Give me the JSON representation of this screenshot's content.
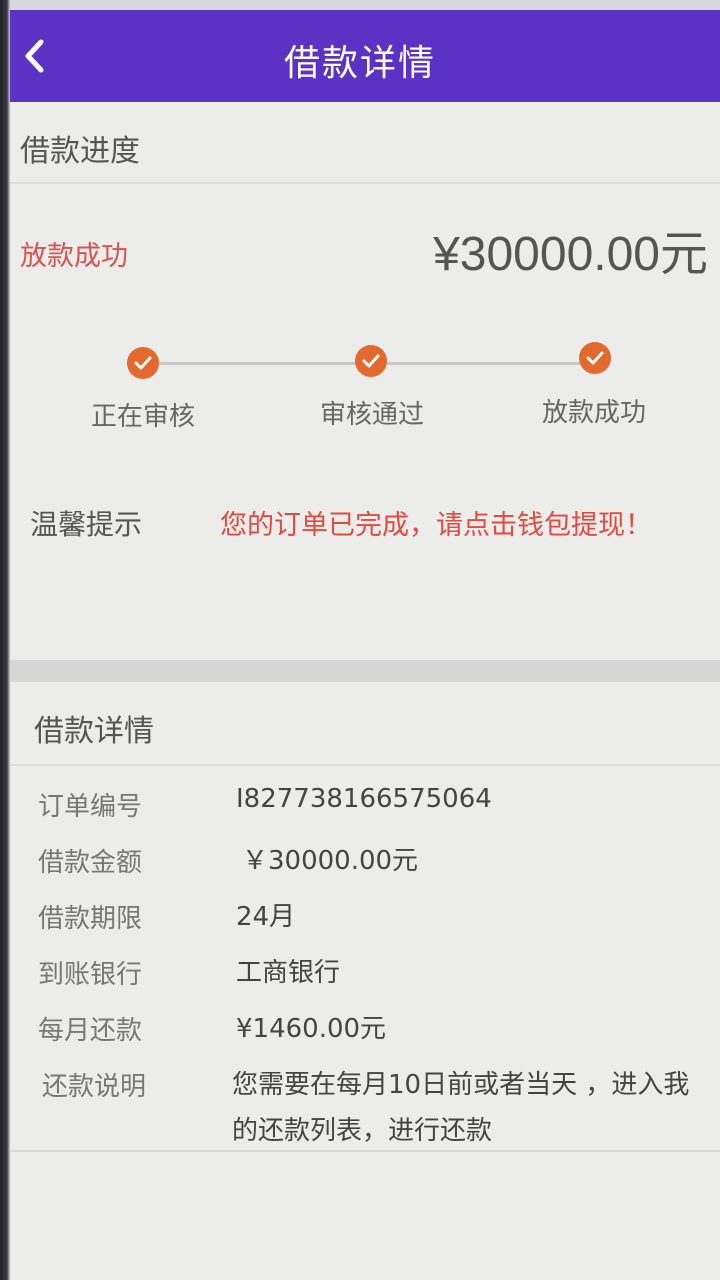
{
  "header": {
    "title": "借款详情"
  },
  "progress_section": {
    "title": "借款进度",
    "status": "放款成功",
    "amount": "¥30000.00元",
    "steps": [
      {
        "label": "正在审核"
      },
      {
        "label": "审核通过"
      },
      {
        "label": "放款成功"
      }
    ],
    "tip_label": "温馨提示",
    "tip_text": "您的订单已完成，请点击钱包提现！"
  },
  "details_section": {
    "title": "借款详情",
    "rows": [
      {
        "label": "订单编号",
        "value": "I827738166575064"
      },
      {
        "label": "借款金额",
        "value": "￥30000.00元"
      },
      {
        "label": "借款期限",
        "value": "24月"
      },
      {
        "label": "到账银行",
        "value": "工商银行"
      },
      {
        "label": "每月还款",
        "value": "¥1460.00元"
      },
      {
        "label": "还款说明",
        "value": "您需要在每月10日前或者当天 ，进入我的还款列表，进行还款"
      }
    ]
  },
  "colors": {
    "header_bg": "#5b32c4",
    "accent_orange": "#e36a2e",
    "alert_red": "#e34a40"
  },
  "icons": {
    "back": "chevron-left-icon",
    "step_done": "check-icon"
  }
}
